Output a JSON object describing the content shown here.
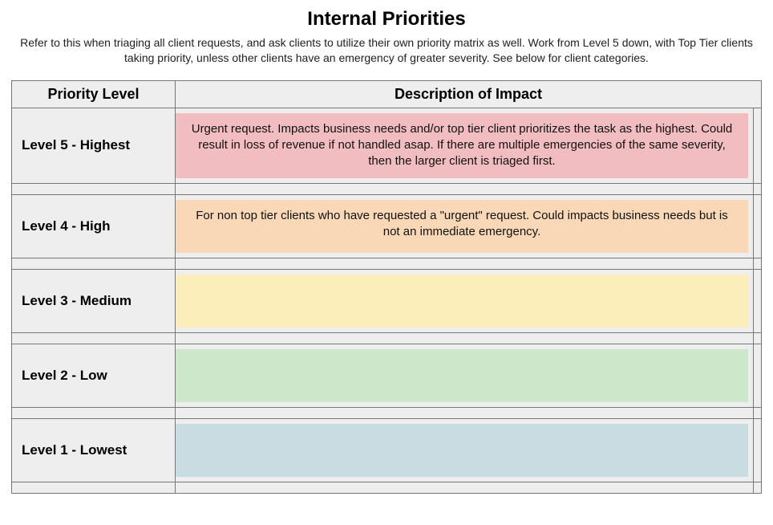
{
  "title": "Internal Priorities",
  "subtitle": "Refer to this when triaging all client requests, and ask clients to utilize their own priority matrix as well. Work from Level 5 down, with Top Tier clients taking priority, unless other clients have an emergency of greater severity. See below for client categories.",
  "headers": {
    "level": "Priority Level",
    "desc": "Description of Impact"
  },
  "rows": [
    {
      "level": "Level 5 - Highest",
      "desc": "Urgent request. Impacts business needs and/or top tier client prioritizes the task as the highest. Could result in loss of revenue if not handled asap. If there are multiple emergencies of the same severity, then the larger client is triaged first.",
      "color": "c-5"
    },
    {
      "level": "Level 4 - High",
      "desc": "For non top tier clients who have requested a \"urgent\" request. Could impacts business needs but is not an immediate emergency.",
      "color": "c-4"
    },
    {
      "level": "Level 3 - Medium",
      "desc": "",
      "color": "c-3"
    },
    {
      "level": "Level 2 - Low",
      "desc": "",
      "color": "c-2"
    },
    {
      "level": "Level 1 - Lowest",
      "desc": "",
      "color": "c-1"
    }
  ]
}
